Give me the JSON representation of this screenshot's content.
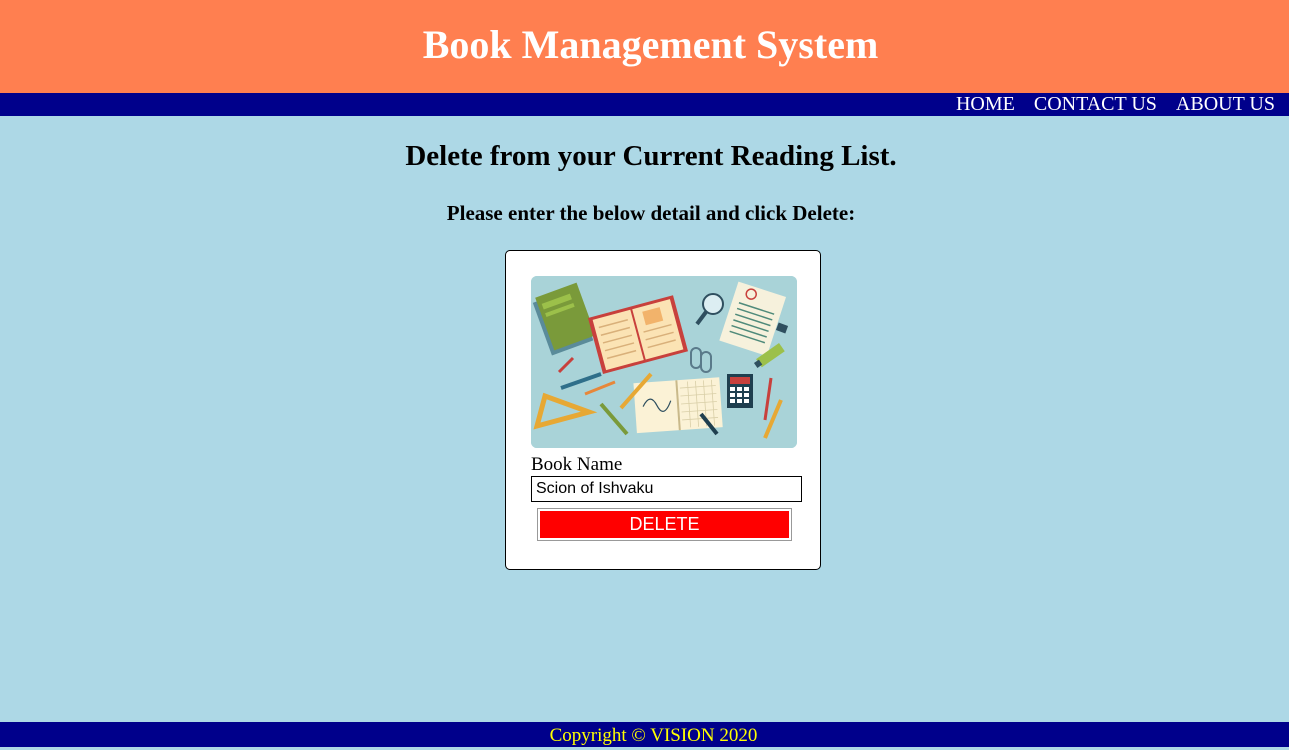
{
  "header": {
    "title": "Book Management System"
  },
  "nav": {
    "items": [
      {
        "label": "HOME"
      },
      {
        "label": "CONTACT US"
      },
      {
        "label": "ABOUT US"
      }
    ]
  },
  "main": {
    "title": "Delete from your Current Reading List.",
    "subtitle": "Please enter the below detail and click Delete:"
  },
  "form": {
    "book_name_label": "Book Name",
    "book_name_value": "Scion of Ishvaku",
    "delete_label": "DELETE"
  },
  "footer": {
    "text": "Copyright © VISION 2020"
  },
  "colors": {
    "header_bg": "#ff7f50",
    "nav_bg": "#00008b",
    "page_bg": "#add8e6",
    "button_bg": "#ff0000",
    "footer_text": "#ffff00"
  }
}
